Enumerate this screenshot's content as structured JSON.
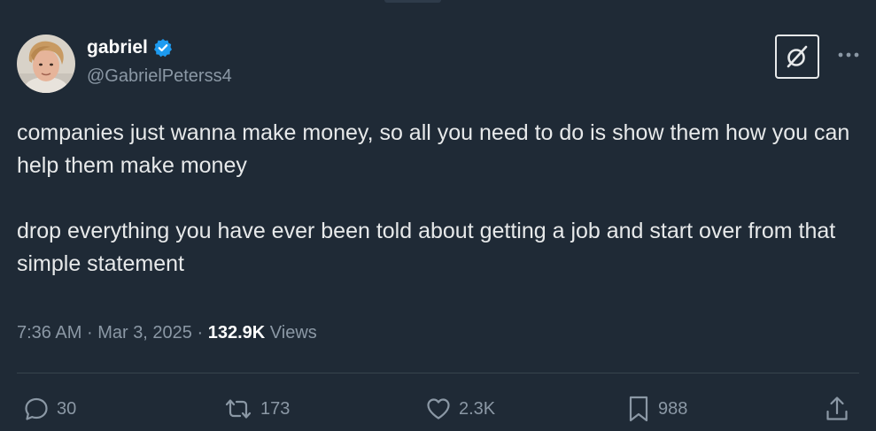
{
  "author": {
    "display_name": "gabriel",
    "handle": "@GabrielPeterss4",
    "avatar_icon": "avatar-photo",
    "verified": true
  },
  "tweet": {
    "text": "companies just wanna make money, so all you need to do is show them how you can help them make money\n\ndrop everything you have ever been told about getting a job and start over from that simple statement",
    "time": "7:36 AM",
    "date": "Mar 3, 2025",
    "separator": "·",
    "views_count": "132.9K",
    "views_label": "Views"
  },
  "actions": {
    "reply_count": "30",
    "repost_count": "173",
    "like_count": "2.3K",
    "bookmark_count": "988"
  },
  "icons": {
    "verified": "verified-badge-icon",
    "grok": "grok-icon",
    "more": "more-options-icon",
    "reply": "reply-icon",
    "repost": "repost-icon",
    "like": "heart-icon",
    "bookmark": "bookmark-icon",
    "share": "share-icon"
  },
  "colors": {
    "background": "#1f2a36",
    "text": "#e7e9ea",
    "secondary_text": "#8b98a5",
    "verified_blue": "#1d9bf0",
    "divider": "#38444d"
  }
}
